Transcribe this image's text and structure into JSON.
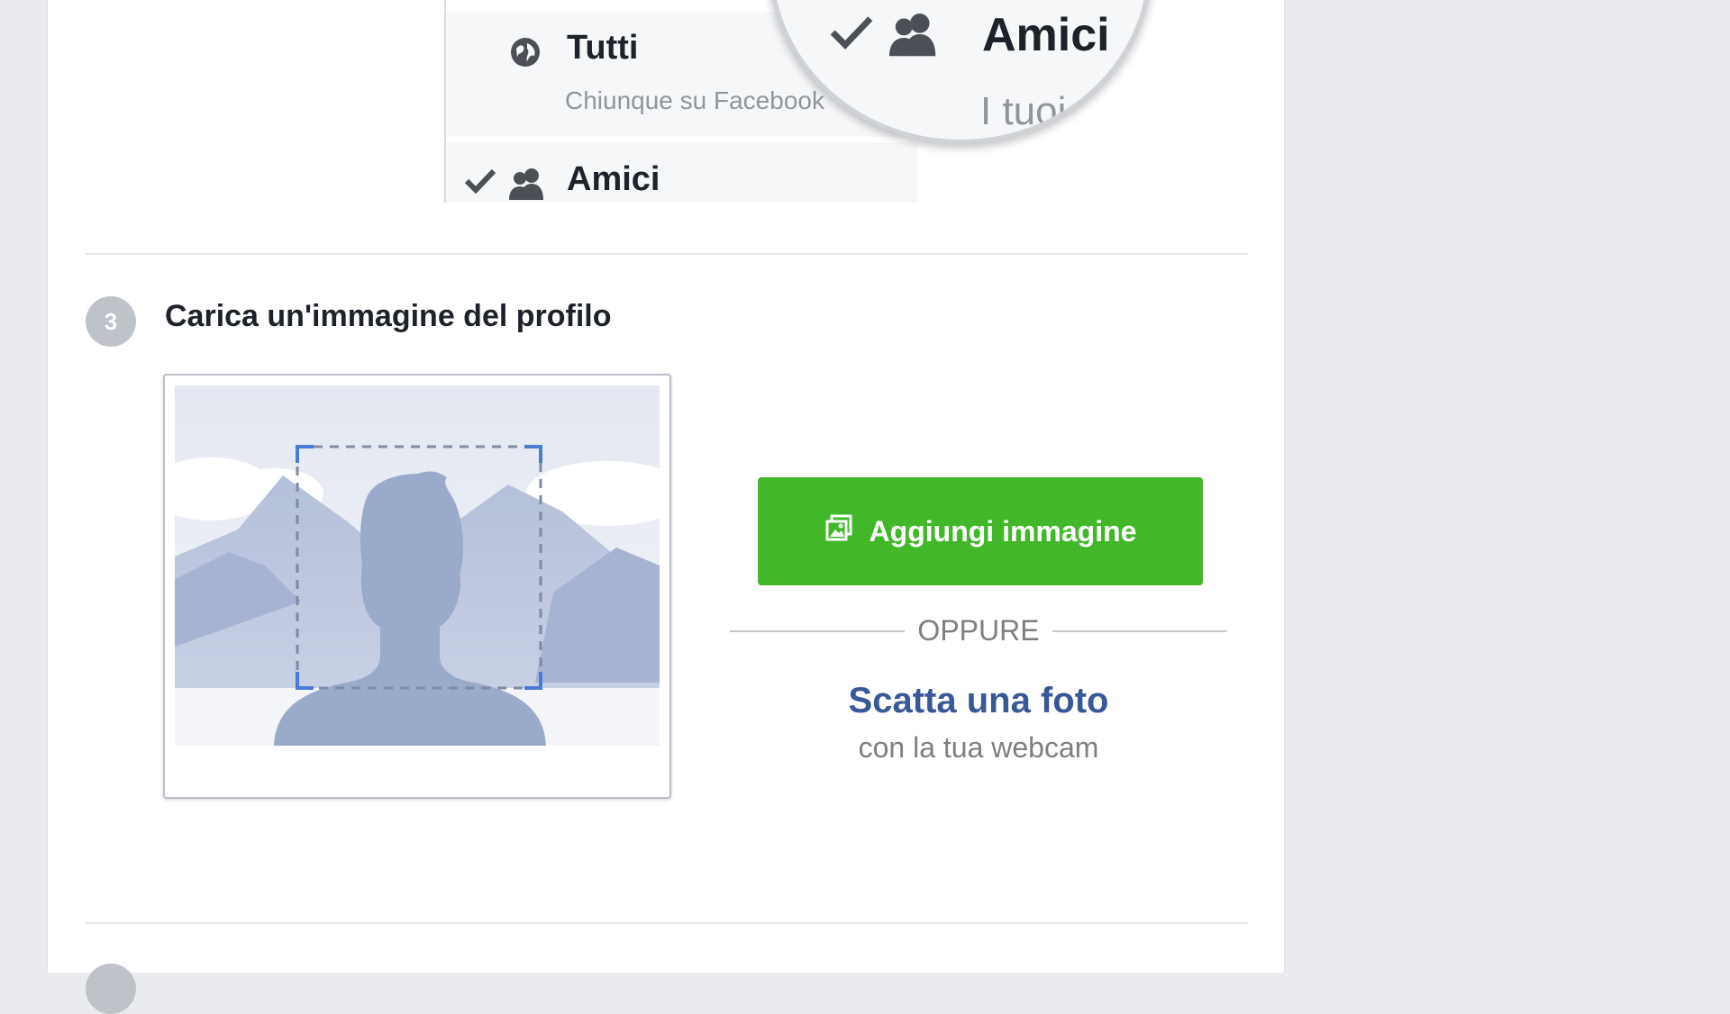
{
  "privacy_menu": {
    "option_everyone": {
      "title": "Tutti",
      "subtitle": "Chiunque su Facebook"
    },
    "option_friends": {
      "title": "Amici"
    },
    "magnified": {
      "title": "Amici",
      "subtitle": "I tuoi amici"
    }
  },
  "step3": {
    "number": "3",
    "title": "Carica un'immagine del profilo",
    "add_button_label": "Aggiungi immagine",
    "or_label": "OPPURE",
    "take_photo_label": "Scatta una foto",
    "webcam_sublabel": "con la tua webcam"
  },
  "colors": {
    "page_background": "#e9ebee",
    "add_button": "#42b72a",
    "link": "#385898",
    "placeholder_silhouette": "#9aaaca"
  },
  "icons": {
    "everyone": "globe-icon",
    "friends": "friends-icon",
    "selected": "checkmark-icon",
    "add_image": "photo-icon"
  }
}
